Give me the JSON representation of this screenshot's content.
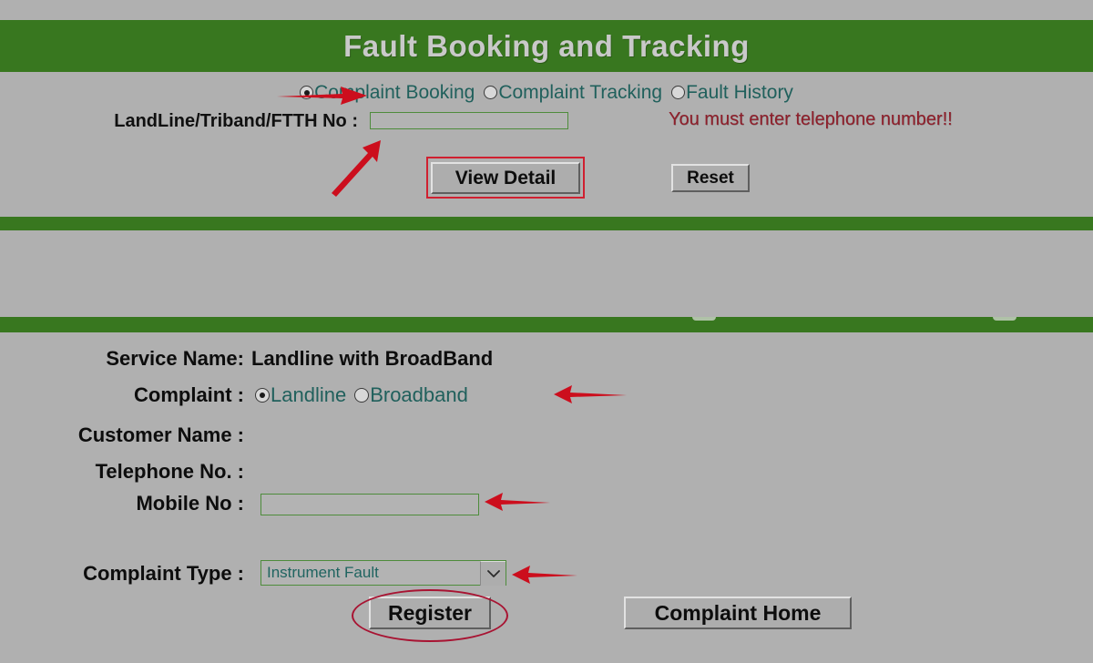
{
  "header": {
    "title": "Fault Booking and Tracking",
    "bar_color": "#38771f",
    "title_color": "#c9c9c9"
  },
  "page": {
    "background_color": "#b0b0b0"
  },
  "top_panel": {
    "mode_options": [
      {
        "label": "Complaint Booking",
        "selected": true
      },
      {
        "label": "Complaint Tracking",
        "selected": false
      },
      {
        "label": "Fault History",
        "selected": false
      }
    ],
    "landline_label": "LandLine/Triband/FTTH No :",
    "landline_value": "",
    "landline_placeholder": "",
    "error_message": "You must enter telephone number!!",
    "error_color": "#8f1f2b",
    "view_detail_label": "View Detail",
    "reset_label": "Reset"
  },
  "form": {
    "service_name_label": "Service Name:",
    "service_name_value": "Landline with BroadBand",
    "complaint_label": "Complaint :",
    "complaint_options": [
      {
        "label": "Landline",
        "selected": true
      },
      {
        "label": "Broadband",
        "selected": false
      }
    ],
    "customer_name_label": "Customer Name :",
    "customer_name_value": "",
    "telephone_no_label": "Telephone No. :",
    "telephone_no_value": "",
    "mobile_no_label": "Mobile No :",
    "mobile_no_value": "",
    "mobile_no_placeholder": "",
    "complaint_type_label": "Complaint Type :",
    "complaint_type_selected": "Instrument Fault",
    "register_label": "Register",
    "complaint_home_label": "Complaint Home",
    "field_border_color": "#4e8c3c",
    "radio_label_color": "#20605c"
  },
  "annotations": {
    "arrow_color": "#cc0e1d",
    "highlight_rect_color": "#d02030",
    "highlight_ellipse_color": "#a81332"
  }
}
